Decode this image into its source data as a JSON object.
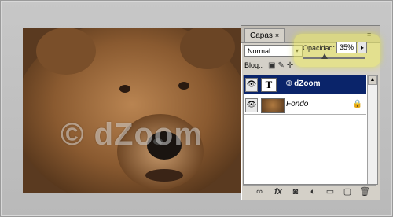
{
  "image": {
    "watermark": "© dZoom"
  },
  "panel": {
    "tab_label": "Capas",
    "tab_close": "×",
    "menu_icon": "≡",
    "blend_mode": "Normal",
    "lock_label": "Bloq.:",
    "opacity_label": "Opacidad:",
    "opacity_value": "35%",
    "opacity_fraction": 0.35
  },
  "layers": [
    {
      "name": "© dZoom",
      "type": "text",
      "thumb": "T",
      "selected": true
    },
    {
      "name": "Fondo",
      "type": "image",
      "locked": true
    }
  ],
  "footer_icons": [
    "link-icon",
    "fx-icon",
    "mask-icon",
    "adjustment-icon",
    "folder-icon",
    "new-layer-icon",
    "trash-icon"
  ],
  "colors": {
    "selected_row": "#0a246a",
    "highlight": "#eeec60"
  }
}
